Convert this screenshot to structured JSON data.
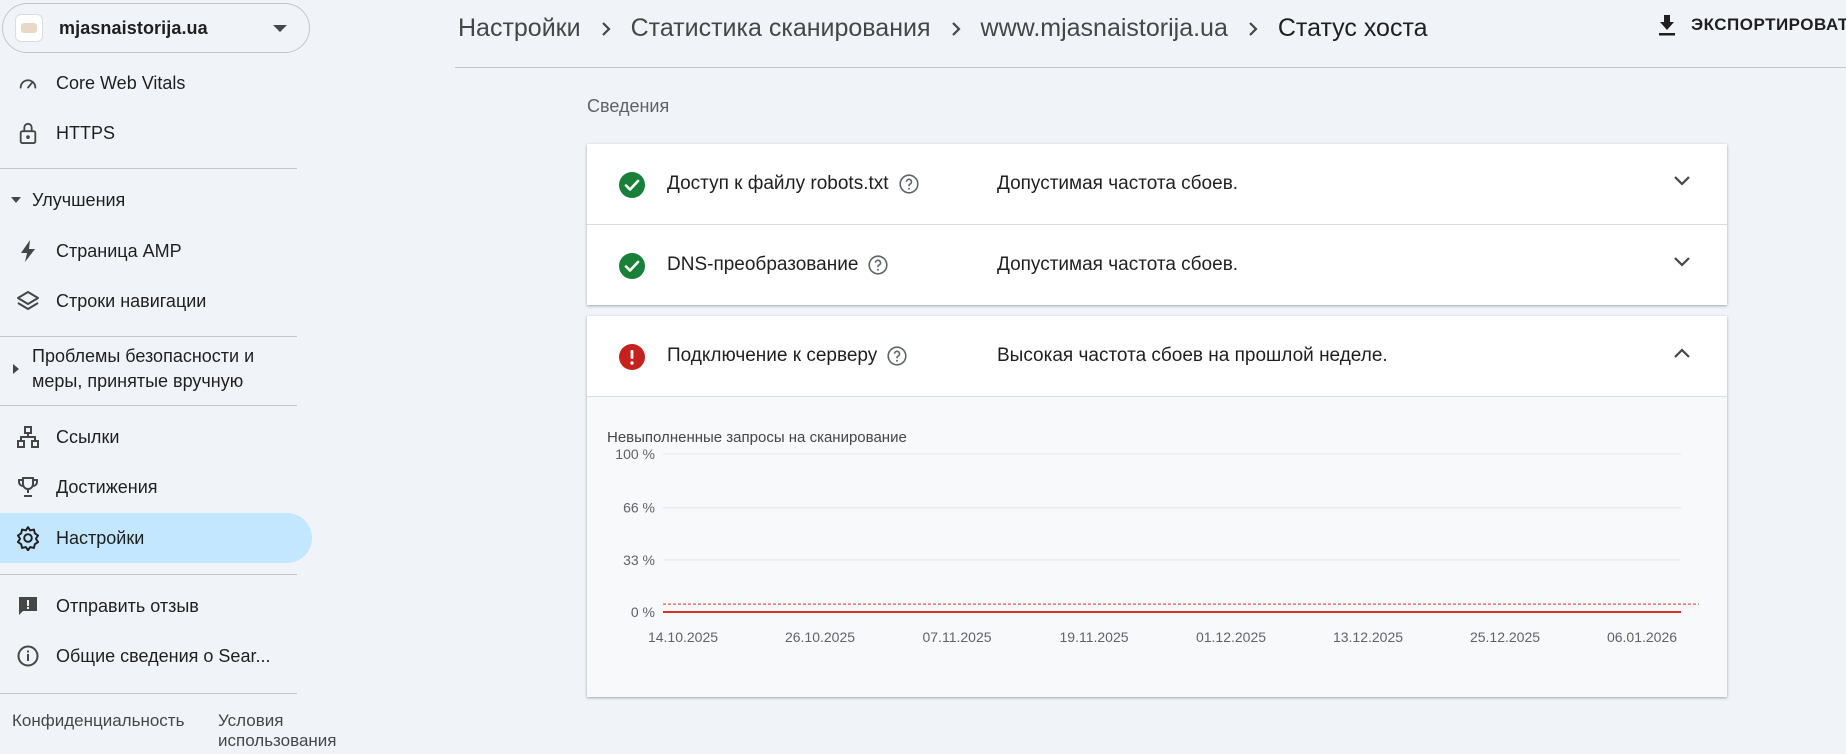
{
  "property": {
    "name": "mjasnaistorija.ua"
  },
  "nav": {
    "core_web_vitals": "Core Web Vitals",
    "https": "HTTPS",
    "enhancements": "Улучшения",
    "amp": "Страница AMP",
    "breadcrumbs": "Строки навигации",
    "security": "Проблемы безопасности и меры, принятые вручную",
    "links": "Ссылки",
    "achievements": "Достижения",
    "settings": "Настройки",
    "feedback": "Отправить отзыв",
    "about": "Общие сведения о Sear..."
  },
  "footer": {
    "privacy": "Конфиденциальность",
    "terms": "Условия использования"
  },
  "header": {
    "crumbs": [
      "Настройки",
      "Статистика сканирования",
      "www.mjasnaistorija.ua"
    ],
    "current": "Статус хоста",
    "export": "ЭКСПОРТИРОВАТ"
  },
  "main": {
    "section_title": "Сведения",
    "rows": [
      {
        "title": "Доступ к файлу robots.txt",
        "status": "ok",
        "description": "Допустимая частота сбоев."
      },
      {
        "title": "DNS-преобразование",
        "status": "ok",
        "description": "Допустимая частота сбоев."
      },
      {
        "title": "Подключение к серверу",
        "status": "error",
        "description": "Высокая частота сбоев на прошлой неделе."
      }
    ]
  },
  "colors": {
    "ok": "#188038",
    "error": "#c5221f",
    "active_nav": "#c2e7ff",
    "line": "#d93025"
  },
  "chart_data": {
    "type": "line",
    "title": "Невыполненные запросы на сканирование",
    "ylim": [
      0,
      100
    ],
    "yticks": [
      "100 %",
      "66 %",
      "33 %",
      "0 %"
    ],
    "ytick_values": [
      100,
      66,
      33,
      0
    ],
    "xticks": [
      "14.10.2025",
      "26.10.2025",
      "07.11.2025",
      "19.11.2025",
      "01.12.2025",
      "13.12.2025",
      "25.12.2025",
      "06.01.2026"
    ],
    "threshold": 5,
    "series": [
      {
        "x": [
          "2025-10-14",
          "2025-10-15",
          "2025-10-16",
          "2025-10-17",
          "2025-10-18",
          "2025-10-19",
          "2025-10-20",
          "2025-10-21",
          "2025-10-22",
          "2025-10-23",
          "2025-10-24",
          "2025-10-25",
          "2025-10-26",
          "2025-10-27",
          "2025-10-28",
          "2025-10-29",
          "2025-10-30",
          "2025-10-31",
          "2025-11-01",
          "2025-11-02",
          "2025-11-03",
          "2025-11-04",
          "2025-11-05",
          "2025-11-06",
          "2025-11-07",
          "2025-11-08",
          "2025-11-09",
          "2025-11-10",
          "2025-11-11",
          "2025-11-12",
          "2025-11-13",
          "2025-11-14",
          "2025-11-15",
          "2025-11-16",
          "2025-11-17",
          "2025-11-18",
          "2025-11-19",
          "2025-11-20",
          "2025-11-21",
          "2025-11-22",
          "2025-11-23",
          "2025-11-24",
          "2025-11-25",
          "2025-11-26",
          "2025-11-27",
          "2025-11-28",
          "2025-11-29",
          "2025-11-30",
          "2025-12-01",
          "2025-12-02",
          "2025-12-03",
          "2025-12-04",
          "2025-12-05",
          "2025-12-06",
          "2025-12-07",
          "2025-12-08",
          "2025-12-09",
          "2025-12-10",
          "2025-12-11",
          "2025-12-12",
          "2025-12-13",
          "2025-12-14",
          "2025-12-15",
          "2025-12-16",
          "2025-12-17",
          "2025-12-18",
          "2025-12-19",
          "2025-12-20",
          "2025-12-21",
          "2025-12-22",
          "2025-12-23",
          "2025-12-24",
          "2025-12-25",
          "2025-12-26",
          "2025-12-27",
          "2025-12-28",
          "2025-12-29",
          "2025-12-30",
          "2025-12-31",
          "2026-01-01",
          "2026-01-02",
          "2026-01-03",
          "2026-01-04",
          "2026-01-05",
          "2026-01-06",
          "2026-01-07",
          "2026-01-08",
          "2026-01-09",
          "2026-01-10",
          "2026-01-11"
        ],
        "values": [
          0,
          0,
          0,
          0,
          0,
          0,
          0,
          0,
          0,
          0,
          0,
          0,
          0,
          0,
          0,
          0,
          0,
          0,
          0,
          0,
          0,
          0,
          0,
          0,
          0,
          0,
          0,
          0,
          0,
          0,
          0,
          0,
          0,
          0,
          0,
          0,
          0,
          0,
          0,
          0,
          0,
          0,
          0,
          0,
          0,
          0,
          0,
          0,
          0,
          0,
          0,
          0,
          0,
          0,
          0,
          0,
          0,
          0,
          0,
          0,
          0,
          0,
          0,
          0,
          0,
          0,
          0,
          0,
          0,
          0,
          0,
          0,
          0,
          0,
          0,
          0,
          0,
          0,
          0,
          0,
          0,
          0,
          0,
          0,
          0,
          0,
          0,
          0,
          0,
          0
        ]
      }
    ]
  }
}
